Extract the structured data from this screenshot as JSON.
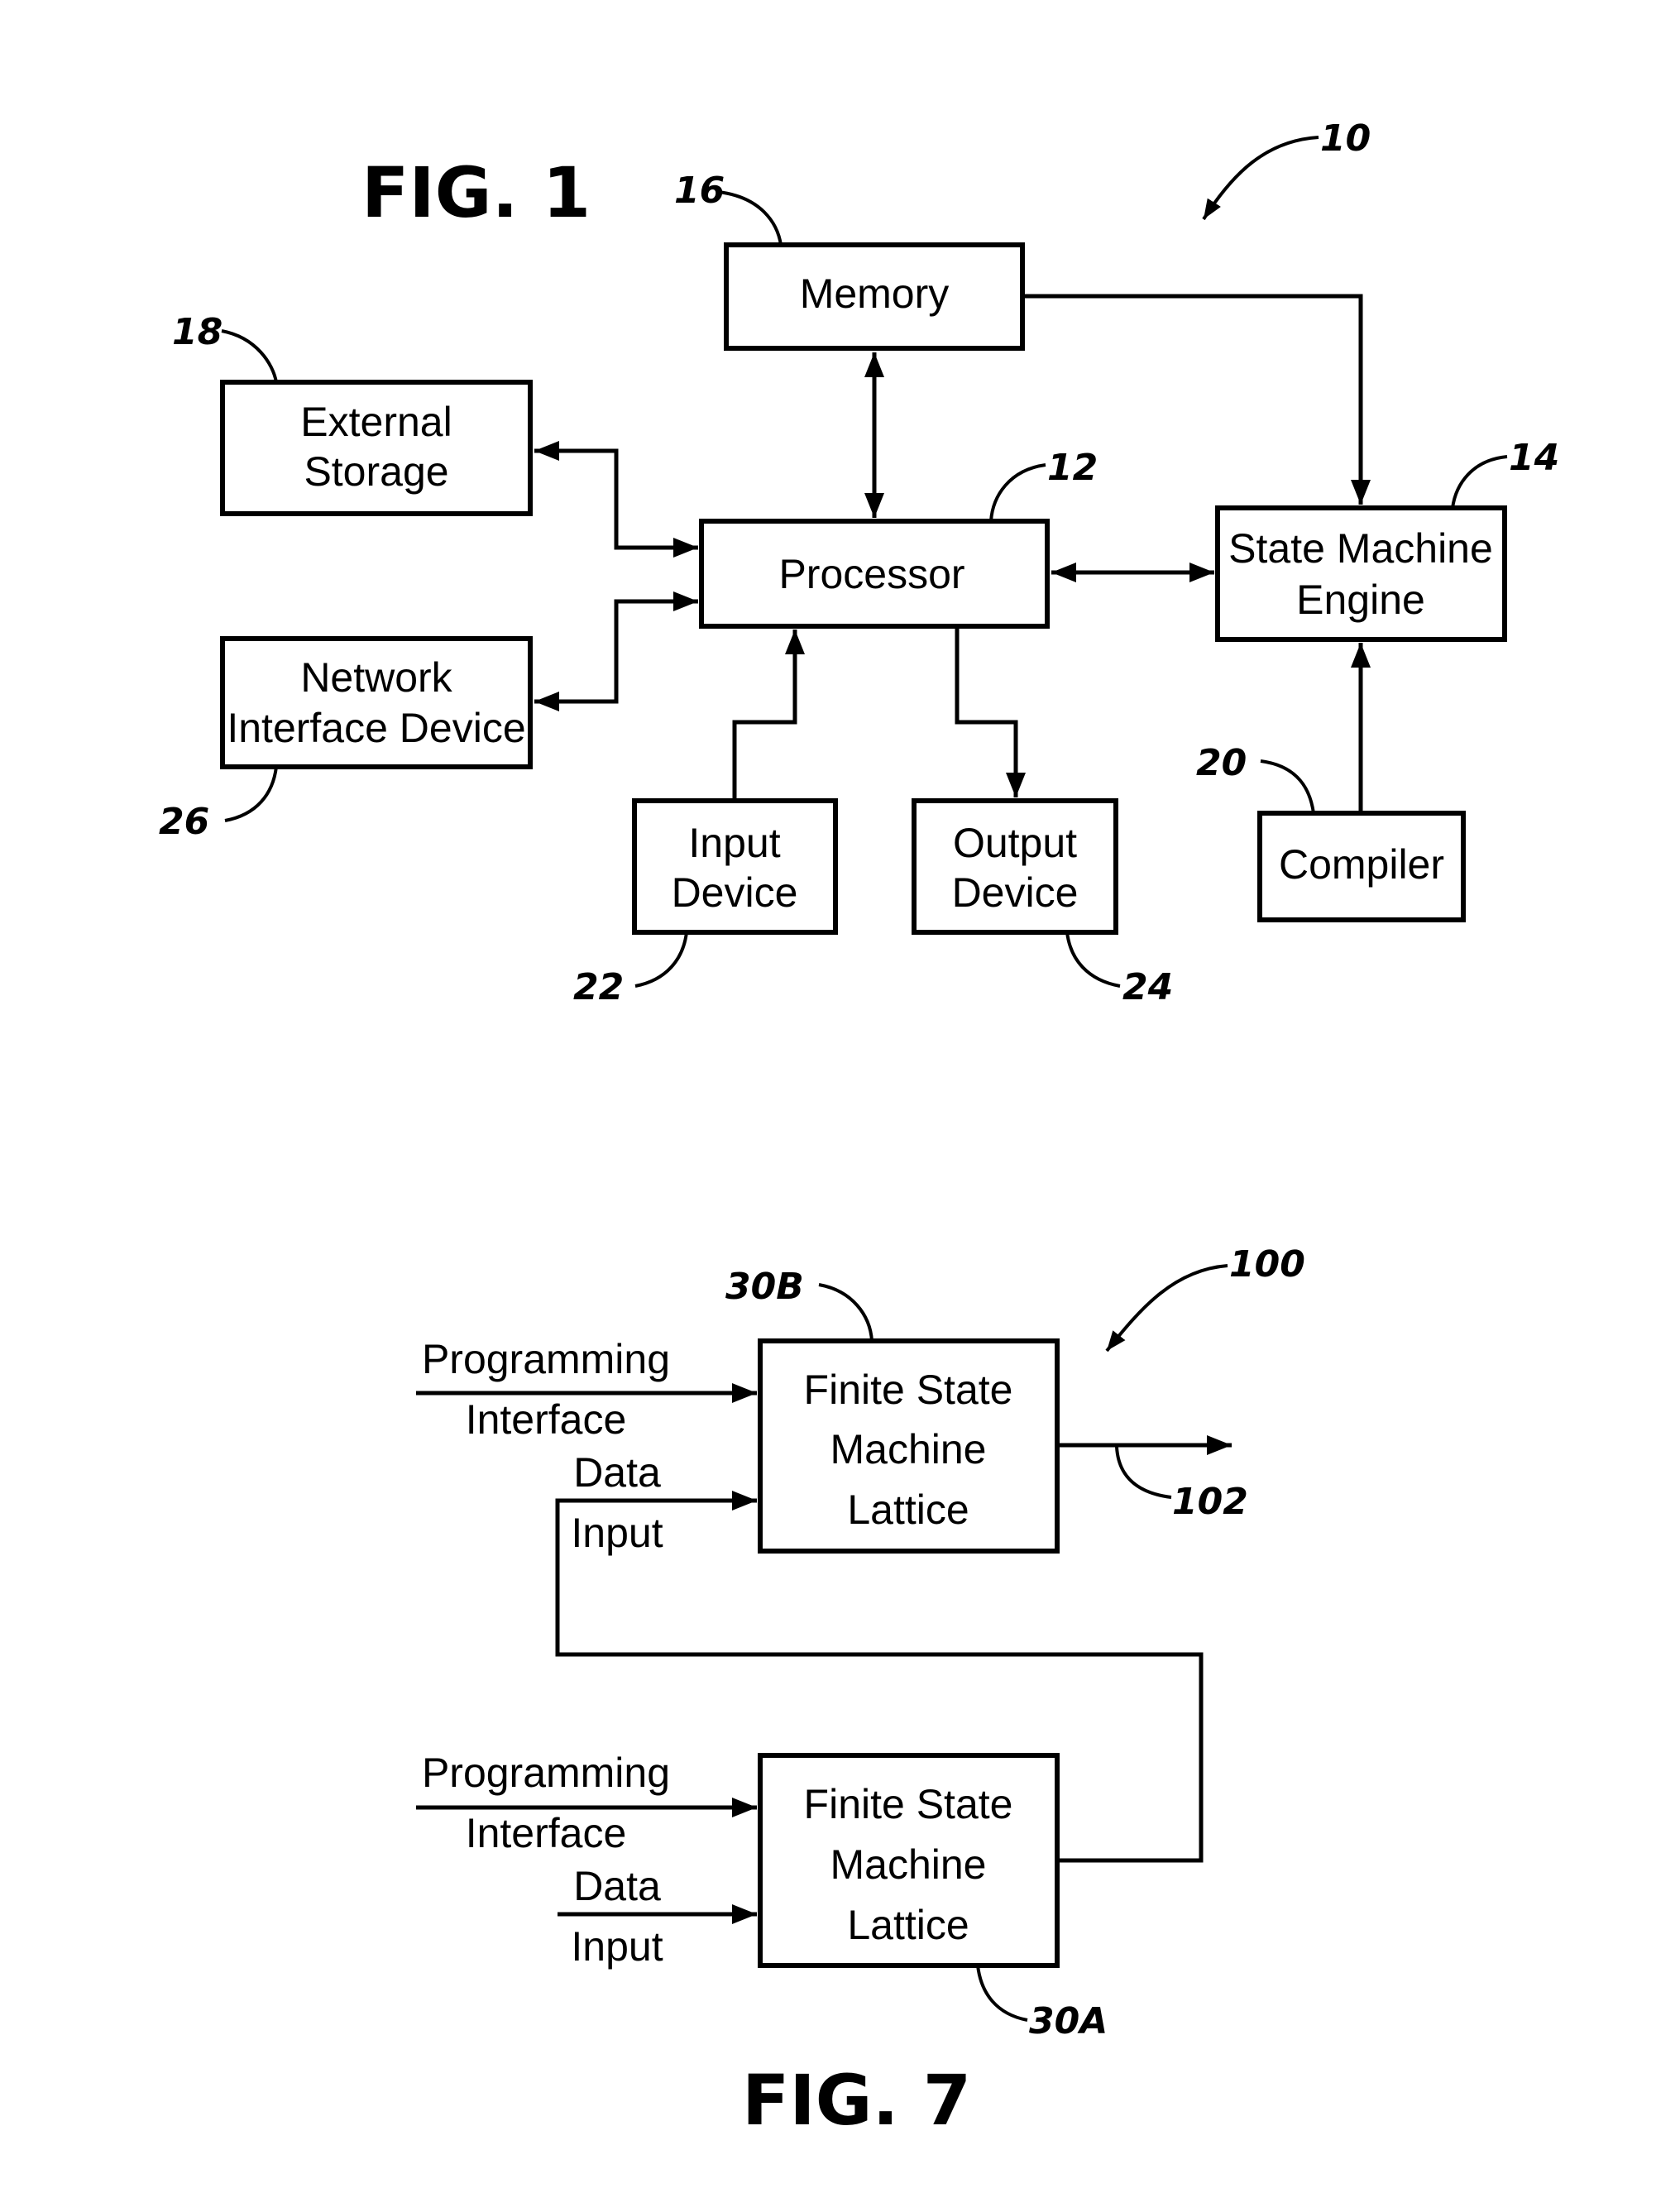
{
  "fig1": {
    "title": "FIG. 1",
    "system_ref": "10",
    "blocks": {
      "memory": {
        "label": [
          "Memory"
        ],
        "ref": "16"
      },
      "external_storage": {
        "label": [
          "External",
          "Storage"
        ],
        "ref": "18"
      },
      "processor": {
        "label": [
          "Processor"
        ],
        "ref": "12"
      },
      "state_machine_engine": {
        "label": [
          "State Machine",
          "Engine"
        ],
        "ref": "14"
      },
      "network_interface_device": {
        "label": [
          "Network",
          "Interface Device"
        ],
        "ref": "26"
      },
      "input_device": {
        "label": [
          "Input",
          "Device"
        ],
        "ref": "22"
      },
      "output_device": {
        "label": [
          "Output",
          "Device"
        ],
        "ref": "24"
      },
      "compiler": {
        "label": [
          "Compiler"
        ],
        "ref": "20"
      }
    },
    "connections": [
      {
        "from": "memory",
        "to": "processor",
        "direction": "bidirectional"
      },
      {
        "from": "memory",
        "to": "state_machine_engine",
        "direction": "forward"
      },
      {
        "from": "processor",
        "to": "external_storage",
        "direction": "bidirectional"
      },
      {
        "from": "processor",
        "to": "network_interface_device",
        "direction": "bidirectional"
      },
      {
        "from": "processor",
        "to": "state_machine_engine",
        "direction": "bidirectional"
      },
      {
        "from": "input_device",
        "to": "processor",
        "direction": "forward"
      },
      {
        "from": "processor",
        "to": "output_device",
        "direction": "forward"
      },
      {
        "from": "compiler",
        "to": "state_machine_engine",
        "direction": "forward"
      }
    ]
  },
  "fig7": {
    "title": "FIG. 7",
    "system_ref": "100",
    "output_ref": "102",
    "lattice_b": {
      "label": [
        "Finite State",
        "Machine",
        "Lattice"
      ],
      "ref": "30B"
    },
    "lattice_a": {
      "label": [
        "Finite State",
        "Machine",
        "Lattice"
      ],
      "ref": "30A"
    },
    "inputs": {
      "programming_interface": [
        "Programming",
        "Interface"
      ],
      "data_input": [
        "Data",
        "Input"
      ]
    },
    "connections": [
      {
        "from": "lattice_a",
        "to": "lattice_b",
        "port": "data_input"
      },
      {
        "from": "lattice_b",
        "to": "output_102"
      }
    ]
  }
}
